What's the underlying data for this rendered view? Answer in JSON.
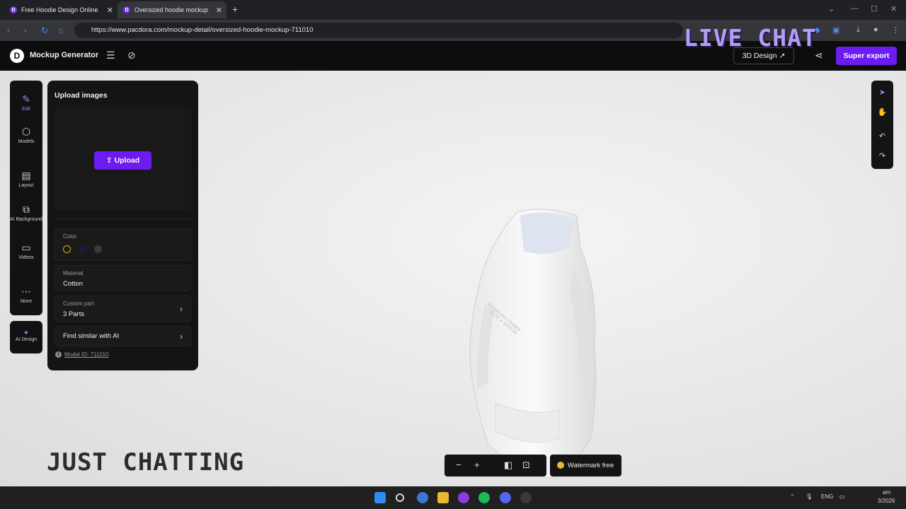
{
  "browser": {
    "tabs": [
      {
        "title": "Free Hoodie Design Online",
        "active": false
      },
      {
        "title": "Oversized hoodie mockup",
        "active": true
      }
    ],
    "url": "https://www.pacdora.com/mockup-detail/oversized-hoodie-mockup-711010"
  },
  "header": {
    "brand": "Mockup Generator",
    "btn_3d": "3D Design ↗",
    "btn_export": "Super export",
    "overlay_text": "LIVE CHAT"
  },
  "left_rail": {
    "items": [
      {
        "label": "Edit",
        "icon": "edit-icon"
      },
      {
        "label": "Models",
        "icon": "cube-icon"
      },
      {
        "label": "Layout",
        "icon": "layout-icon"
      },
      {
        "label": "AI Background",
        "icon": "ai-background-icon"
      },
      {
        "label": "Videos",
        "icon": "video-icon"
      },
      {
        "label": "More",
        "icon": "more-icon"
      }
    ],
    "ai_design": "AI Design"
  },
  "panel": {
    "title": "Upload images",
    "upload_label": "Upload",
    "color_label": "Color",
    "material_label": "Material",
    "material_value": "Cotton",
    "custom_part_label": "Custom part",
    "custom_part_value": "3 Parts",
    "find_similar": "Find similar with AI",
    "model_id": "Model ID: 711010"
  },
  "bottom": {
    "watermark": "Watermark free"
  },
  "stream_overlay": {
    "category": "JUST CHATTING"
  },
  "taskbar": {
    "lang": "ENG",
    "time": "am",
    "date": "3/2026"
  },
  "colors": {
    "accent": "#6c1bf0",
    "panel_bg": "#141414",
    "canvas_bg": "#e6e6e6"
  }
}
